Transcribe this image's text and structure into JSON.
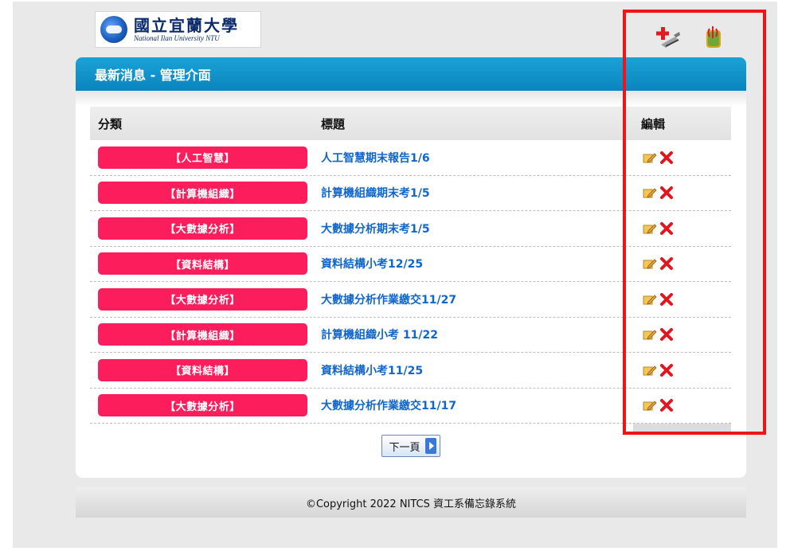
{
  "header": {
    "logo": {
      "zh": "國立宜蘭大學",
      "en": "National Ilan University NTU"
    },
    "toolbar": {
      "add_icon": "add-post-icon",
      "logout_icon": "logout-icon"
    }
  },
  "panel": {
    "title": "最新消息 - 管理介面"
  },
  "table": {
    "headers": {
      "category": "分類",
      "title": "標題",
      "edit": "編輯"
    },
    "rows": [
      {
        "category": "【人工智慧】",
        "title": "人工智慧期末報告1/6"
      },
      {
        "category": "【計算機組織】",
        "title": "計算機組織期末考1/5"
      },
      {
        "category": "【大數據分析】",
        "title": "大數據分析期末考1/5"
      },
      {
        "category": "【資料結構】",
        "title": "資料結構小考12/25"
      },
      {
        "category": "【大數據分析】",
        "title": "大數據分析作業繳交11/27"
      },
      {
        "category": "【計算機組織】",
        "title": "計算機組織小考 11/22"
      },
      {
        "category": "【資料結構】",
        "title": "資料結構小考11/25"
      },
      {
        "category": "【大數據分析】",
        "title": "大數據分析作業繳交11/17"
      }
    ]
  },
  "pagination": {
    "next_label": "下一頁"
  },
  "footer": {
    "copyright": "©Copyright 2022 NITCS 資工系備忘錄系統"
  },
  "colors": {
    "accent_blue": "#0a84be",
    "category_pink": "#fb1d5c",
    "link_blue": "#1166cc",
    "highlight_red": "#f0141a"
  }
}
